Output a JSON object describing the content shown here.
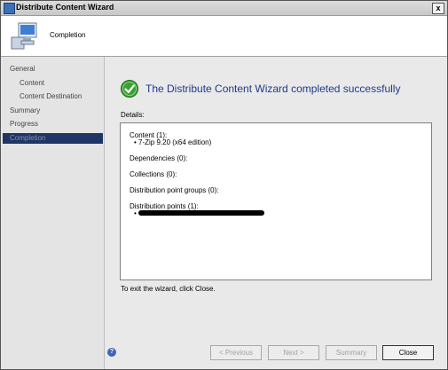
{
  "window": {
    "title": "Distribute Content Wizard",
    "close_glyph": "x"
  },
  "header": {
    "title": "Completion",
    "icon": "computer-icon"
  },
  "nav": {
    "items": [
      {
        "label": "General",
        "level": 0,
        "selected": false
      },
      {
        "label": "Content",
        "level": 1,
        "selected": false
      },
      {
        "label": "Content Destination",
        "level": 1,
        "selected": false
      },
      {
        "label": "Summary",
        "level": 0,
        "selected": false
      },
      {
        "label": "Progress",
        "level": 0,
        "selected": false
      },
      {
        "label": "Completion",
        "level": 0,
        "selected": true
      }
    ]
  },
  "main": {
    "success_message": "The Distribute Content Wizard completed successfully",
    "details_label": "Details:",
    "details": {
      "content_header": "Content (1):",
      "content_item": "•  7-Zip 9.20 (x64 edition)",
      "dependencies": "Dependencies (0):",
      "collections": "Collections (0):",
      "dp_groups": "Distribution point groups (0):",
      "dps": "Distribution points (1):",
      "dps_bullet": "•"
    },
    "exit_text": "To exit the wizard, click Close."
  },
  "footer": {
    "help_glyph": "?",
    "previous": "< Previous",
    "next": "Next >",
    "summary": "Summary",
    "close": "Close"
  },
  "colors": {
    "selected_nav": "#1e3565",
    "success_text": "#1f3a8c",
    "check_green": "#3aa135"
  }
}
